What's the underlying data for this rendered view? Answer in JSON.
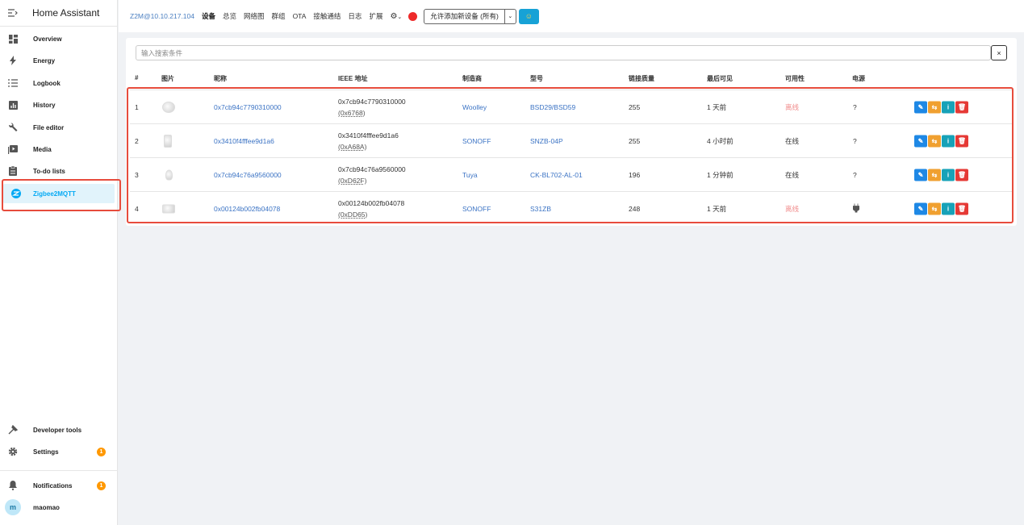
{
  "sidebar": {
    "title": "Home Assistant",
    "items": [
      {
        "label": "Overview",
        "icon": "dashboard-icon"
      },
      {
        "label": "Energy",
        "icon": "lightning-icon"
      },
      {
        "label": "Logbook",
        "icon": "list-icon"
      },
      {
        "label": "History",
        "icon": "chart-icon"
      },
      {
        "label": "File editor",
        "icon": "wrench-icon"
      },
      {
        "label": "Media",
        "icon": "media-icon"
      },
      {
        "label": "To-do lists",
        "icon": "clipboard-icon"
      },
      {
        "label": "Zigbee2MQTT",
        "icon": "zigbee-icon"
      }
    ],
    "bottom_items": [
      {
        "label": "Developer tools",
        "icon": "hammer-icon"
      },
      {
        "label": "Settings",
        "icon": "gear-icon",
        "badge": "1"
      },
      {
        "label": "Notifications",
        "icon": "bell-icon",
        "badge": "1"
      }
    ],
    "user": {
      "name": "maomao",
      "initial": "m"
    }
  },
  "topnav": {
    "brand": "Z2M@10.10.217.104",
    "links": [
      "设备",
      "总览",
      "网络图",
      "群组",
      "OTA",
      "接触通结",
      "日志",
      "扩展"
    ],
    "permit_label": "允许添加新设备 (所有)"
  },
  "search": {
    "placeholder": "输入搜索条件",
    "clear": "×"
  },
  "table": {
    "headers": [
      "#",
      "图片",
      "昵称",
      "IEEE 地址",
      "制造商",
      "型号",
      "链接质量",
      "最后可见",
      "可用性",
      "电源"
    ],
    "rows": [
      {
        "num": "1",
        "name": "0x7cb94c7790310000",
        "ieee": "0x7cb94c7790310000",
        "nwk": "(0x6768)",
        "vendor": "Woolley",
        "model": "BSD29/BSD59",
        "lqi": "255",
        "last_seen": "1 天前",
        "availability": "离线",
        "power": "?"
      },
      {
        "num": "2",
        "name": "0x3410f4fffee9d1a6",
        "ieee": "0x3410f4fffee9d1a6",
        "nwk": "(0xA68A)",
        "vendor": "SONOFF",
        "model": "SNZB-04P",
        "lqi": "255",
        "last_seen": "4 小时前",
        "availability": "在线",
        "power": "?"
      },
      {
        "num": "3",
        "name": "0x7cb94c76a9560000",
        "ieee": "0x7cb94c76a9560000",
        "nwk": "(0xD62F)",
        "vendor": "Tuya",
        "model": "CK-BL702-AL-01",
        "lqi": "196",
        "last_seen": "1 分钟前",
        "availability": "在线",
        "power": "?"
      },
      {
        "num": "4",
        "name": "0x00124b002fb04078",
        "ieee": "0x00124b002fb04078",
        "nwk": "(0xDD65)",
        "vendor": "SONOFF",
        "model": "S31ZB",
        "lqi": "248",
        "last_seen": "1 天前",
        "availability": "离线",
        "power": "plug-icon"
      }
    ]
  },
  "colors": {
    "accent": "#03a9f4",
    "highlight_frame": "#e74c3c",
    "link": "#3b73c4",
    "offline": "#f08a8a"
  }
}
